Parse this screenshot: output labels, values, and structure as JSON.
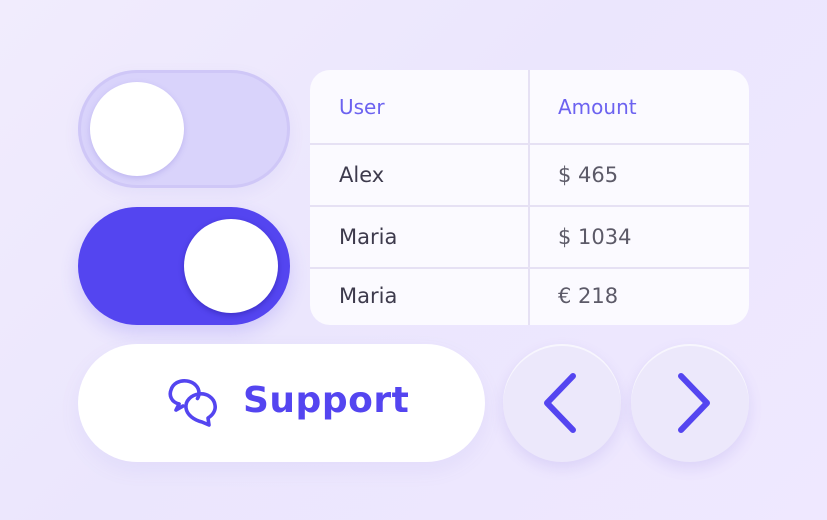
{
  "toggles": [
    {
      "state": "off",
      "color": "#d9d3fb"
    },
    {
      "state": "on",
      "color": "#5445f0"
    }
  ],
  "table": {
    "headers": {
      "user": "User",
      "amount": "Amount"
    },
    "rows": [
      {
        "user": "Alex",
        "amount": "$ 465"
      },
      {
        "user": "Maria",
        "amount": "$ 1034"
      },
      {
        "user": "Maria",
        "amount": "€ 218"
      }
    ]
  },
  "support_button": {
    "label": "Support",
    "icon": "chat-bubbles-icon"
  },
  "navigation": {
    "prev_icon": "chevron-left-icon",
    "next_icon": "chevron-right-icon"
  },
  "colors": {
    "accent": "#5445f0",
    "header_text": "#6c62f0",
    "background": "#efeafd"
  }
}
